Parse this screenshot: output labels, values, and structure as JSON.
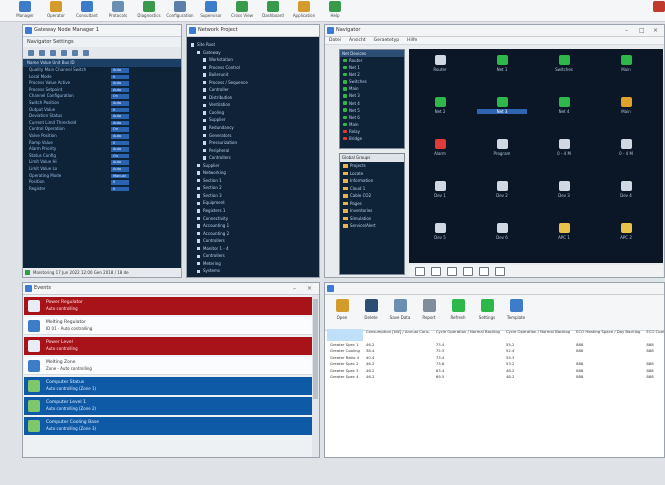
{
  "ribbon": {
    "buttons": [
      {
        "label": "Manager",
        "icon": "monitor-icon",
        "color": "#3c7cc9"
      },
      {
        "label": "Operator",
        "icon": "user-icon",
        "color": "#d39a2c"
      },
      {
        "label": "Consultant",
        "icon": "chart-icon",
        "color": "#3c7cc9"
      },
      {
        "label": "Protocols",
        "icon": "document-icon",
        "color": "#6b8fb3"
      },
      {
        "label": "Diagnostics",
        "icon": "wrench-icon",
        "color": "#3a9a4c"
      },
      {
        "label": "Configuration",
        "icon": "settings-icon",
        "color": "#5b7fa8"
      },
      {
        "label": "Supervisor",
        "icon": "eye-icon",
        "color": "#3c7cc9"
      },
      {
        "label": "Cross View",
        "icon": "grid-icon",
        "color": "#3a9a4c"
      },
      {
        "label": "Dashboard",
        "icon": "gauge-icon",
        "color": "#3a9a4c"
      },
      {
        "label": "Application",
        "icon": "app-icon",
        "color": "#d39a2c"
      },
      {
        "label": "Help",
        "icon": "help-icon",
        "color": "#3a9a4c"
      }
    ],
    "corner_icon_color": "#c0392b"
  },
  "panel_properties": {
    "title": "Gateway Node Manager 1",
    "menu": "Navigator   Settings",
    "header": "Name   Value   Unit   Bus ID",
    "rows": [
      {
        "name": "Quality Main Channel Switch",
        "value": "Auto"
      },
      {
        "name": "Local Mode",
        "value": "0"
      },
      {
        "name": "Process Value Active",
        "value": "Auto"
      },
      {
        "name": "Process Setpoint",
        "value": "Auto"
      },
      {
        "name": "Channel Configuration",
        "value": "On"
      },
      {
        "name": "Switch Position",
        "value": "Auto"
      },
      {
        "name": "Output Value",
        "value": "0"
      },
      {
        "name": "Deviation Status",
        "value": "Auto"
      },
      {
        "name": "Current Limit Threshold",
        "value": "Auto"
      },
      {
        "name": "Control Operation",
        "value": "On"
      },
      {
        "name": "Valve Position",
        "value": "Auto"
      },
      {
        "name": "Ramp Value",
        "value": "0"
      },
      {
        "name": "Alarm Priority",
        "value": "Auto"
      },
      {
        "name": "Status Config",
        "value": "On"
      },
      {
        "name": "Limit Value Hi",
        "value": "Auto"
      },
      {
        "name": "Limit Value Lo",
        "value": "Auto"
      },
      {
        "name": "Operating Mode",
        "value": "Manual"
      },
      {
        "name": "Position",
        "value": "0"
      },
      {
        "name": "Register",
        "value": "0"
      }
    ],
    "status": "Monitoring  17 Jun 2022  12:00  Gen 2018  / 18 de"
  },
  "panel_tree": {
    "title": "Network Project",
    "items": [
      {
        "label": "Site Root",
        "depth": 0
      },
      {
        "label": "Gateway",
        "depth": 1
      },
      {
        "label": "Workstation",
        "depth": 2
      },
      {
        "label": "Process Control",
        "depth": 2
      },
      {
        "label": "Boilerunit",
        "depth": 2
      },
      {
        "label": "Process / Sequence",
        "depth": 2
      },
      {
        "label": "Controller",
        "depth": 2
      },
      {
        "label": "Distribution",
        "depth": 2
      },
      {
        "label": "Ventilation",
        "depth": 2
      },
      {
        "label": "Cooling",
        "depth": 2
      },
      {
        "label": "Supplier",
        "depth": 2
      },
      {
        "label": "Redundancy",
        "depth": 2
      },
      {
        "label": "Generators",
        "depth": 2
      },
      {
        "label": "Pressurization",
        "depth": 2
      },
      {
        "label": "Peripheral",
        "depth": 2
      },
      {
        "label": "Controllers",
        "depth": 2
      },
      {
        "label": "Supplier",
        "depth": 1
      },
      {
        "label": "Networking",
        "depth": 1
      },
      {
        "label": "Section 1",
        "depth": 1
      },
      {
        "label": "Section 2",
        "depth": 1
      },
      {
        "label": "Section 3",
        "depth": 1
      },
      {
        "label": "Equipment",
        "depth": 1
      },
      {
        "label": "Registers 1",
        "depth": 1
      },
      {
        "label": "Connectivity",
        "depth": 1
      },
      {
        "label": "Accounting 1",
        "depth": 1
      },
      {
        "label": "Accounting 2",
        "depth": 1
      },
      {
        "label": "Controllers",
        "depth": 1
      },
      {
        "label": "Monitor 1 - 4",
        "depth": 1
      },
      {
        "label": "Controllers",
        "depth": 1
      },
      {
        "label": "Metering",
        "depth": 1
      },
      {
        "label": "Systems",
        "depth": 1
      }
    ]
  },
  "panel_navigator": {
    "title": "Navigator",
    "menu": [
      "Datei",
      "Ansicht",
      "Geraetetyp",
      "Hilfe"
    ],
    "devices_header": "Net Devices",
    "devices": [
      {
        "label": "Router",
        "color": "#2fb84a"
      },
      {
        "label": "Net 1",
        "color": "#2fb84a"
      },
      {
        "label": "Net 2",
        "color": "#2fb84a"
      },
      {
        "label": "Switches",
        "color": "#2fb84a"
      },
      {
        "label": "Main",
        "color": "#2fb84a"
      },
      {
        "label": "Net 3",
        "color": "#2fb84a"
      },
      {
        "label": "Net 4",
        "color": "#2fb84a"
      },
      {
        "label": "Net 5",
        "color": "#2fb84a"
      },
      {
        "label": "Net 6",
        "color": "#2fb84a"
      },
      {
        "label": "Main",
        "color": "#2fb84a"
      },
      {
        "label": "Relay",
        "color": "#e03a3a"
      },
      {
        "label": "Bridge",
        "color": "#e03a3a"
      }
    ],
    "groups_header": "Global Groups",
    "groups": [
      "Projects",
      "Locate",
      "Information",
      "Cloud 1",
      "Cable CO2",
      "Pages",
      "Inventories",
      "Simulation",
      "Service/Alert"
    ],
    "grid": [
      {
        "label": "Router",
        "color": "#cfd8e3",
        "selected": false
      },
      {
        "label": "Net 1",
        "color": "#2fb84a",
        "selected": false
      },
      {
        "label": "Switches",
        "color": "#2fb84a",
        "selected": false
      },
      {
        "label": "Main",
        "color": "#2fb84a",
        "selected": false
      },
      {
        "label": "Net 2",
        "color": "#2fb84a",
        "selected": false
      },
      {
        "label": "Net 3",
        "color": "#2fb84a",
        "selected": true
      },
      {
        "label": "Net 4",
        "color": "#2fb84a",
        "selected": false
      },
      {
        "label": "Main",
        "color": "#e0a22a",
        "selected": false
      },
      {
        "label": "Alarm",
        "color": "#e03a3a",
        "selected": false
      },
      {
        "label": "Program",
        "color": "#cfd8e3",
        "selected": false
      },
      {
        "label": "0 - 4 M",
        "color": "#cfd8e3",
        "selected": false
      },
      {
        "label": "0 - 4 M",
        "color": "#cfd8e3",
        "selected": false
      },
      {
        "label": "Dev 1",
        "color": "#cfd8e3",
        "selected": false
      },
      {
        "label": "Dev 2",
        "color": "#cfd8e3",
        "selected": false
      },
      {
        "label": "Dev 3",
        "color": "#cfd8e3",
        "selected": false
      },
      {
        "label": "Dev 4",
        "color": "#cfd8e3",
        "selected": false
      },
      {
        "label": "Dev 5",
        "color": "#cfd8e3",
        "selected": false
      },
      {
        "label": "Dev 6",
        "color": "#cfd8e3",
        "selected": false
      },
      {
        "label": "APC 1",
        "color": "#e9c24a",
        "selected": false
      },
      {
        "label": "APC 2",
        "color": "#e9c24a",
        "selected": false
      }
    ]
  },
  "panel_alarms": {
    "title": "Events",
    "items": [
      {
        "style": "red",
        "line1": "Power Regulator",
        "line2": "Auto controlling",
        "icon_color": "#e7ecf5"
      },
      {
        "style": "white",
        "line1": "Melting Regulator",
        "line2": "ID 01 - Auto controlling",
        "icon_color": "#3c7cc9"
      },
      {
        "style": "red",
        "line1": "Power Level",
        "line2": "Auto controlling",
        "icon_color": "#e7ecf5"
      },
      {
        "style": "white",
        "line1": "Melting Zone",
        "line2": "Zone - Auto controlling",
        "icon_color": "#3c7cc9"
      },
      {
        "style": "blue",
        "line1": "Computer Status",
        "line2": "Auto controlling (Zone 1)",
        "icon_color": "#7fc76b"
      },
      {
        "style": "blue",
        "line1": "Computer Level 1",
        "line2": "Auto controlling (Zone 2)",
        "icon_color": "#7fc76b"
      },
      {
        "style": "blue",
        "line1": "Computer Cooling Base",
        "line2": "Auto controlling (Zone 3)",
        "icon_color": "#7fc76b"
      }
    ]
  },
  "panel_table": {
    "toolbar": [
      {
        "label": "Open",
        "color": "#d39a2c"
      },
      {
        "label": "Delete",
        "color": "#2c4e75"
      },
      {
        "label": "Save Data",
        "color": "#6b8fb3"
      },
      {
        "label": "Report",
        "color": "#7f8c99"
      },
      {
        "label": "Refresh",
        "color": "#2fb84a"
      },
      {
        "label": "Settings",
        "color": "#2fb84a"
      },
      {
        "label": "Template",
        "color": "#3c7cc9"
      }
    ],
    "columns": [
      "",
      "Consumption [kW] / Annual Cons.",
      "Cycle Operation / Normal Backlog",
      "Cycle Operation / Normal Backlog",
      "ECO Heating Space / Day Backlog",
      "ECO Cooling Space / Day Backlog"
    ],
    "rows": [
      [
        "Greater Spec 1",
        "46.2",
        "73.4",
        "55.2",
        "888",
        "888"
      ],
      [
        "Greater Cooling",
        "38.4",
        "75.3",
        "52.4",
        "888",
        "888"
      ],
      [
        "Greater Ratio 4",
        "40.4",
        "73.4",
        "55.3",
        "",
        ""
      ],
      [
        "Greater Spec 2",
        "46.2",
        "73.6",
        "53.2",
        "888",
        "888"
      ],
      [
        "Greater Spec 3",
        "46.2",
        "63.4",
        "48.2",
        "888",
        "888"
      ],
      [
        "Greater Spec 4",
        "46.2",
        "69.5",
        "48.2",
        "888",
        "888"
      ]
    ]
  }
}
